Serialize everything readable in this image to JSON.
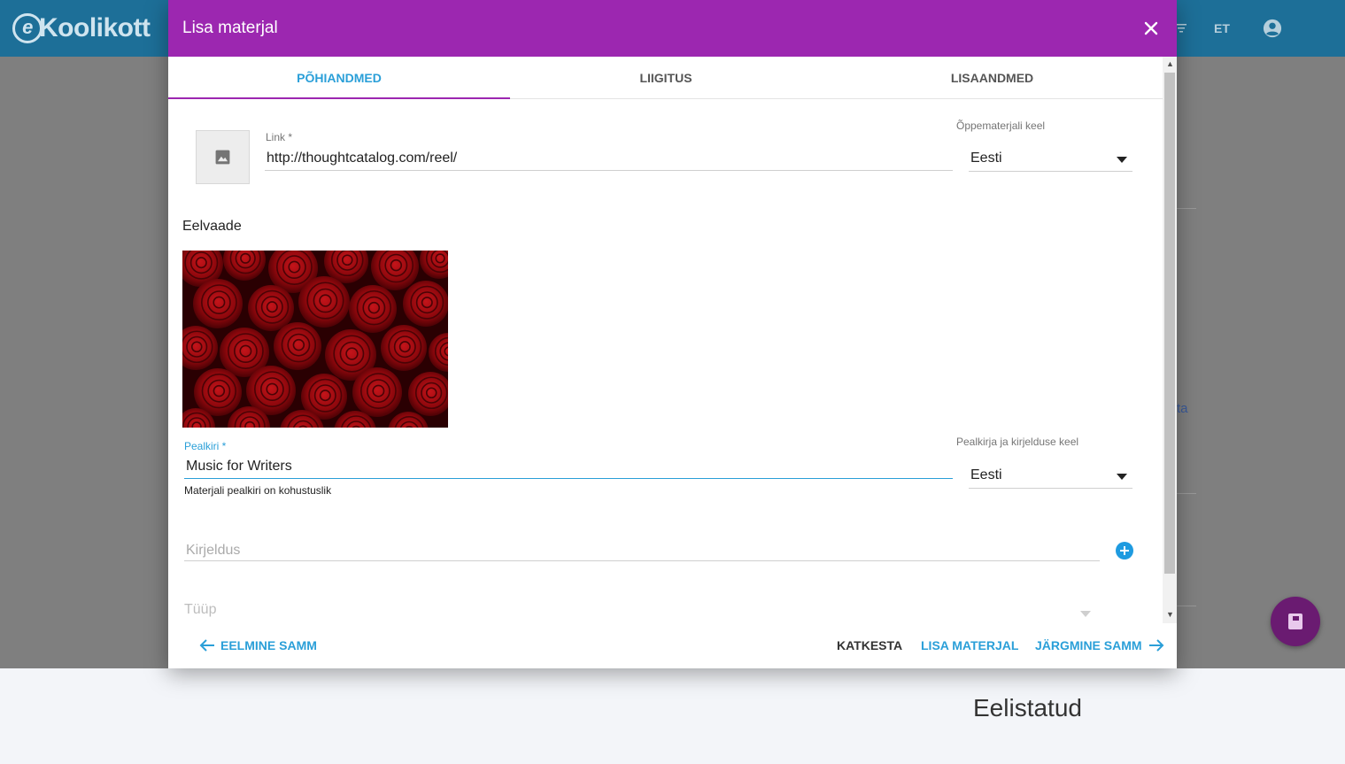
{
  "app": {
    "logo_text": "Koolikott",
    "logo_letter": "e",
    "language": "ET",
    "background_link": "ta",
    "footer_heading": "Eelistatud"
  },
  "dialog": {
    "title": "Lisa materjal",
    "tabs": [
      {
        "label": "PÕHIANDMED",
        "active": true
      },
      {
        "label": "LIIGITUS",
        "active": false
      },
      {
        "label": "LISAANDMED",
        "active": false
      }
    ],
    "link": {
      "label": "Link *",
      "value": "http://thoughtcatalog.com/reel/"
    },
    "material_language": {
      "label": "Õppematerjali keel",
      "value": "Eesti"
    },
    "preview_label": "Eelvaade",
    "title_field": {
      "label": "Pealkiri *",
      "value": "Music for Writers",
      "hint": "Materjali pealkiri on kohustuslik"
    },
    "title_language": {
      "label": "Pealkirja ja kirjelduse keel",
      "value": "Eesti"
    },
    "description": {
      "placeholder": "Kirjeldus"
    },
    "type": {
      "placeholder": "Tüüp"
    },
    "buttons": {
      "previous": "EELMINE SAMM",
      "cancel": "KATKESTA",
      "add": "LISA MATERJAL",
      "next": "JÄRGMINE SAMM"
    }
  },
  "colors": {
    "header_purple": "#9c27b0",
    "accent_blue": "#2a9fd8",
    "app_header": "#1d6f98",
    "fab": "#6a1b71"
  }
}
